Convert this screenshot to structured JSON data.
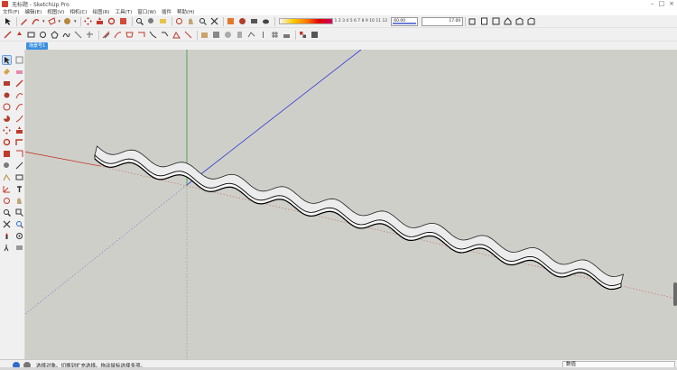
{
  "window": {
    "title": "无标题 - SketchUp Pro",
    "controls": [
      "–",
      "□",
      "×"
    ]
  },
  "menu": [
    "文件(F)",
    "编辑(E)",
    "视图(V)",
    "相机(C)",
    "绘图(R)",
    "工具(T)",
    "窗口(W)",
    "插件",
    "帮助(H)"
  ],
  "toolbar1": {
    "scale_labels": "1 2 3 4 5 6 7 8 9 10 11 12",
    "field_value": "60.00",
    "field_end_value": "17.00"
  },
  "scene": {
    "tab_label": "场景号1"
  },
  "status": {
    "message": "选择对象。切换到扩充选择。拖动鼠标选择多项。"
  },
  "measurements": {
    "label": "数值"
  },
  "colors": {
    "axis_red": "#c0392b",
    "axis_green": "#2e9a3a",
    "axis_blue": "#2f3ad8",
    "viewport_bg": "#cfcfc9",
    "selected_tab": "#3b8fe0"
  },
  "icons": [
    "select-icon",
    "eraser-icon",
    "pencil-icon",
    "arc-icon",
    "paint-bucket-icon",
    "push-pull-icon",
    "move-icon",
    "rotate-icon",
    "scale-icon",
    "offset-icon",
    "tape-measure-icon",
    "text-icon",
    "orbit-icon",
    "pan-icon",
    "zoom-icon",
    "zoom-extents-icon",
    "layers-icon",
    "components-icon",
    "house-icon",
    "shadow-icon"
  ]
}
